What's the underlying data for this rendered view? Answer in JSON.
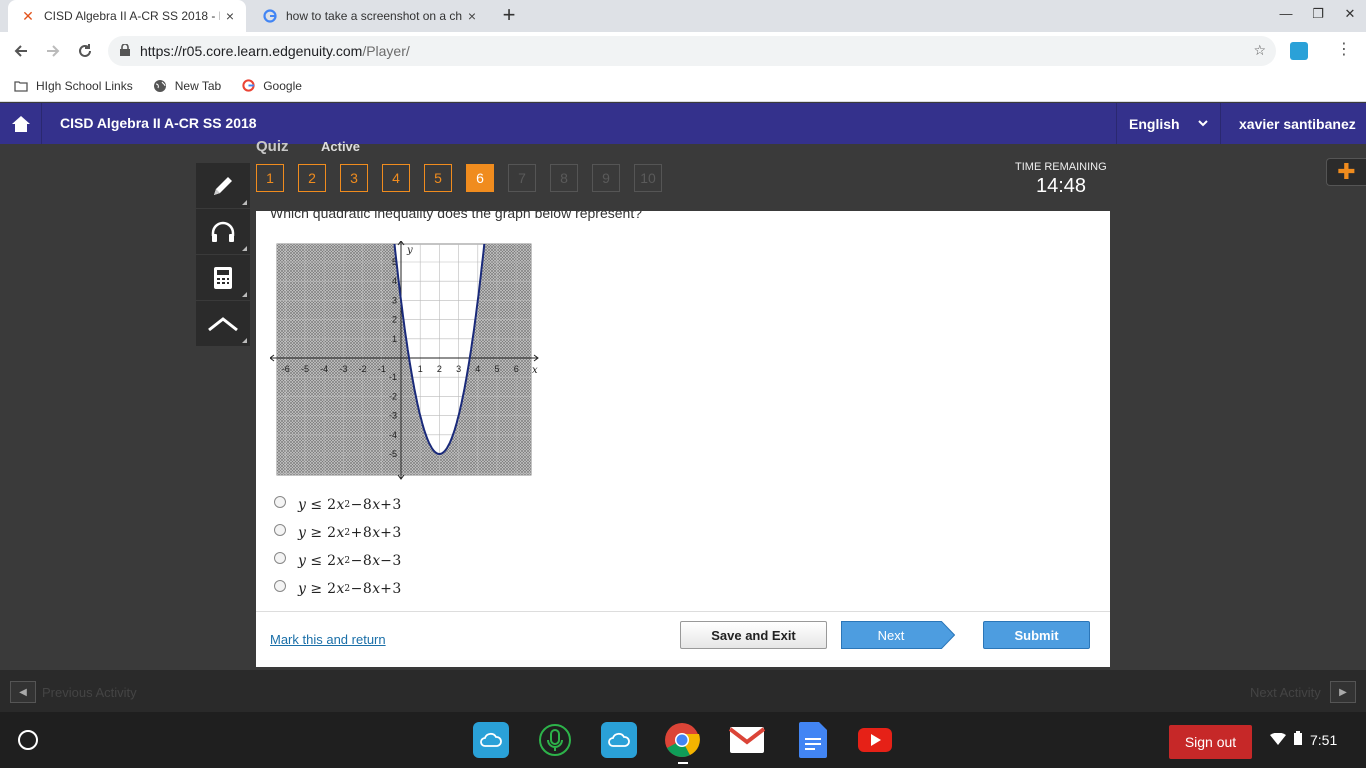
{
  "browser": {
    "tabs": [
      {
        "title": "CISD Algebra II A-CR SS 2018 - E",
        "active": true,
        "favicon": "edgenuity-x-icon"
      },
      {
        "title": "how to take a screenshot on a ch",
        "active": false,
        "favicon": "google-g-icon"
      }
    ],
    "url_host": "https://r05.core.learn.edgenuity.com",
    "url_path": "/Player/",
    "bookmarks": [
      {
        "label": "HIgh School Links",
        "icon": "folder-icon"
      },
      {
        "label": "New Tab",
        "icon": "globe-icon"
      },
      {
        "label": "Google",
        "icon": "google-g-icon"
      }
    ]
  },
  "app": {
    "course_title": "CISD Algebra II A-CR SS 2018",
    "language": "English",
    "user": "xavier santibanez"
  },
  "quiz": {
    "label": "Quiz",
    "status": "Active",
    "questions": [
      "1",
      "2",
      "3",
      "4",
      "5",
      "6",
      "7",
      "8",
      "9",
      "10"
    ],
    "current": 6,
    "answered_up_to": 5,
    "time_label": "TIME REMAINING",
    "time_value": "14:48",
    "prompt": "Which quadratic inequality does the graph below represent?",
    "options": [
      {
        "var": "y",
        "rel": "≤",
        "coef": "2",
        "v": "x",
        "exp": "2",
        "mid": "−8",
        "v2": "x",
        "tail": "+3"
      },
      {
        "var": "y",
        "rel": "≥",
        "coef": "2",
        "v": "x",
        "exp": "2",
        "mid": "+8",
        "v2": "x",
        "tail": "+3"
      },
      {
        "var": "y",
        "rel": "≤",
        "coef": "2",
        "v": "x",
        "exp": "2",
        "mid": "−8",
        "v2": "x",
        "tail": "−3"
      },
      {
        "var": "y",
        "rel": "≥",
        "coef": "2",
        "v": "x",
        "exp": "2",
        "mid": "−8",
        "v2": "x",
        "tail": "+3"
      }
    ],
    "mark_return": "Mark this and return",
    "save_exit": "Save and Exit",
    "next": "Next",
    "submit": "Submit"
  },
  "graph": {
    "x_ticks": [
      "-6",
      "-5",
      "-4",
      "-3",
      "-2",
      "-1",
      "1",
      "2",
      "3",
      "4",
      "5",
      "6"
    ],
    "y_ticks": [
      "5",
      "4",
      "3",
      "2",
      "1",
      "-1",
      "-2",
      "-3",
      "-4",
      "-5"
    ],
    "x_label": "x",
    "y_label": "y",
    "colors": {
      "curve": "#1a2a7a",
      "shade": "#7a7a7a",
      "grid": "#bbbbbb"
    }
  },
  "activity_bar": {
    "prev": "Previous Activity",
    "next": "Next Activity"
  },
  "shelf": {
    "sign_out": "Sign out",
    "time": "7:51"
  },
  "colors": {
    "header": "#34318c",
    "accent": "#f08c1e",
    "button_blue": "#4d9de0",
    "signout_red": "#c62828"
  }
}
